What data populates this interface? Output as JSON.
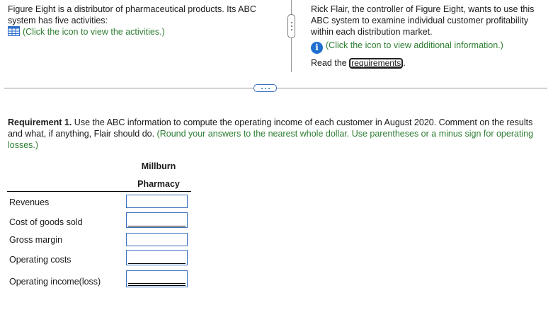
{
  "left_panel": {
    "intro": "Figure Eight is a distributor of pharmaceutical products. Its ABC system has five activities:",
    "activities_link": "(Click the icon to view the activities.)",
    "activities_icon": "table-grid-icon"
  },
  "right_panel": {
    "intro": "Rick Flair, the controller of Figure Eight, wants to use this ABC system to examine individual customer profitability within each distribution market.",
    "info_link": "(Click the icon to view additional information.)",
    "info_icon": "info-icon",
    "read_the": "Read the",
    "requirements_button": "requirements",
    "period": "."
  },
  "requirement": {
    "label": "Requirement 1.",
    "text": " Use the ABC information to compute the operating income of each customer in August 2020. Comment on the results and what, if anything, Flair should do.",
    "instruction": " (Round your answers to the nearest whole dollar. Use parentheses or a minus sign for operating losses.)"
  },
  "table": {
    "header_line1": "Millburn",
    "header_line2": "Pharmacy",
    "rows": [
      {
        "label": "Revenues",
        "value": ""
      },
      {
        "label": "Cost of goods sold",
        "value": ""
      },
      {
        "label": "Gross margin",
        "value": ""
      },
      {
        "label": "Operating costs",
        "value": ""
      },
      {
        "label": "Operating income(loss)",
        "value": ""
      }
    ]
  },
  "colors": {
    "instruction_green": "#2e7d32",
    "input_border": "#3a6fbf",
    "info_blue": "#1f6fd1"
  }
}
